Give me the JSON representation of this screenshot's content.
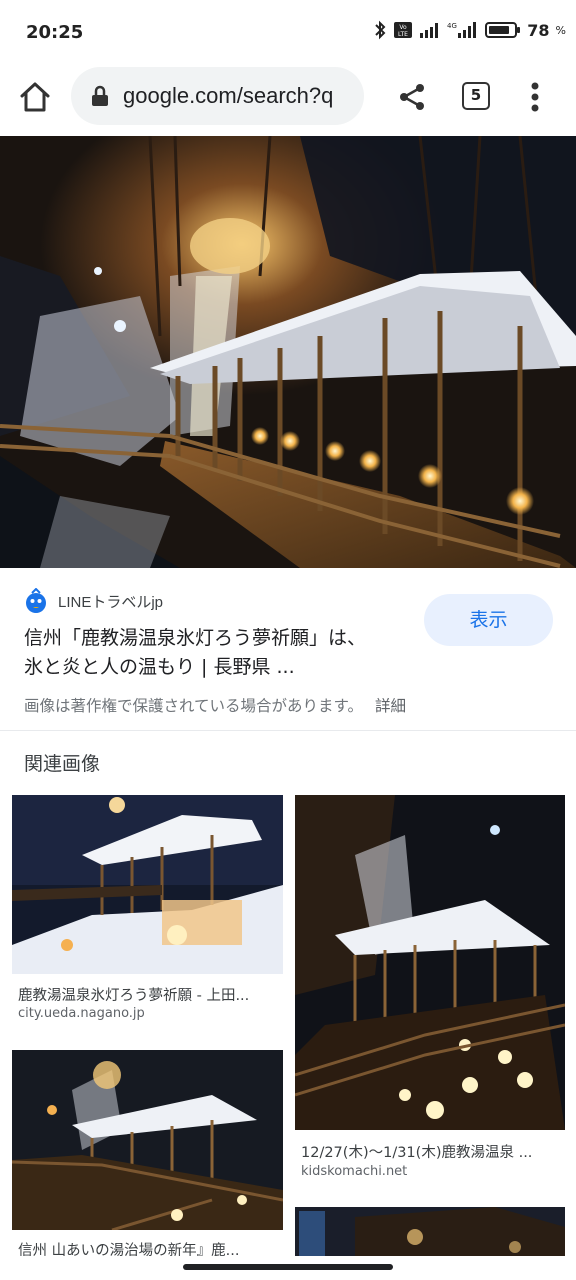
{
  "status_bar": {
    "time": "20:25",
    "network_label": "4G",
    "volte_label": "Vo LTE",
    "battery_percent": "78",
    "battery_unit": "%"
  },
  "toolbar": {
    "url": "google.com/search?q",
    "tab_count": "5",
    "icons": [
      "home-icon",
      "lock-icon",
      "share-icon",
      "tab-switcher-icon",
      "overflow-menu-icon"
    ]
  },
  "result": {
    "source_name": "LINEトラベルjp",
    "title_line1": "信州「鹿教湯温泉氷灯ろう夢祈願」は、",
    "title_line2": "氷と炎と人の温もり | 長野県 ...",
    "view_button": "表示",
    "copyright_notice": "画像は著作権で保護されている場合があります。",
    "details_link": "詳細"
  },
  "related": {
    "heading": "関連画像",
    "items": [
      {
        "caption": "鹿教湯温泉氷灯ろう夢祈願 - 上田...",
        "domain": "city.ueda.nagano.jp"
      },
      {
        "caption": "12/27(木)〜1/31(木)鹿教湯温泉 ...",
        "domain": "kidskomachi.net"
      },
      {
        "caption": "信州 山あいの湯治場の新年』鹿...",
        "domain": ""
      }
    ]
  },
  "colors": {
    "accent": "#1a73e8",
    "view_button_bg": "#e8f0fe",
    "url_pill_bg": "#f1f3f4"
  }
}
